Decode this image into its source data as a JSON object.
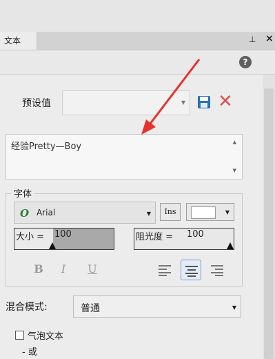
{
  "panel": {
    "tab_label": "文本",
    "pin_icon": "⊥",
    "close_icon": "×",
    "help_icon": "?"
  },
  "preset": {
    "label": "预设值",
    "value": "",
    "save_icon": "save-icon",
    "delete_icon": "✕"
  },
  "text_content": "经验Pretty—Boy",
  "font": {
    "section_label": "字体",
    "font_name": "Arial",
    "ins_label": "Ins",
    "color": "#ffffff",
    "size_label": "大小 =",
    "size_value": "100",
    "opacity_label": "阻光度 =",
    "opacity_value": "100",
    "bold_label": "B",
    "italic_label": "I",
    "underline_label": "U"
  },
  "blend": {
    "label": "混合模式:",
    "value": "普通"
  },
  "bubble": {
    "label": "气泡文本",
    "or_label": "- 或"
  }
}
